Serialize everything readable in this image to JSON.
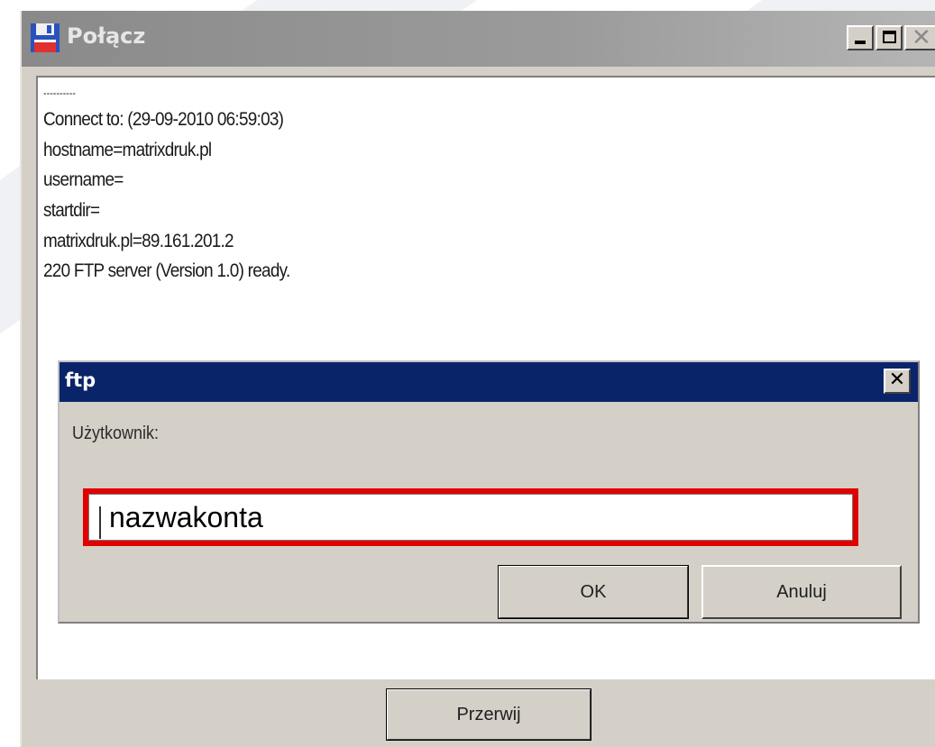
{
  "main_window": {
    "title": "Połącz",
    "icon": "floppy-disk-icon"
  },
  "log": {
    "separator": "----------",
    "lines": [
      "Connect to: (29-09-2010 06:59:03)",
      "hostname=matrixdruk.pl",
      "username=",
      "startdir=",
      "matrixdruk.pl=89.161.201.2",
      "220 FTP server (Version 1.0) ready."
    ]
  },
  "ftp_dialog": {
    "title": "ftp",
    "close_glyph": "✕",
    "user_label": "Użytkownik:",
    "user_value": "nazwakonta",
    "ok_label": "OK",
    "cancel_label": "Anuluj"
  },
  "footer": {
    "abort_label": "Przerwij"
  },
  "colors": {
    "highlight": "#e00000",
    "dialog_titlebar": "#0a246a",
    "window_face": "#d4d0c8"
  }
}
